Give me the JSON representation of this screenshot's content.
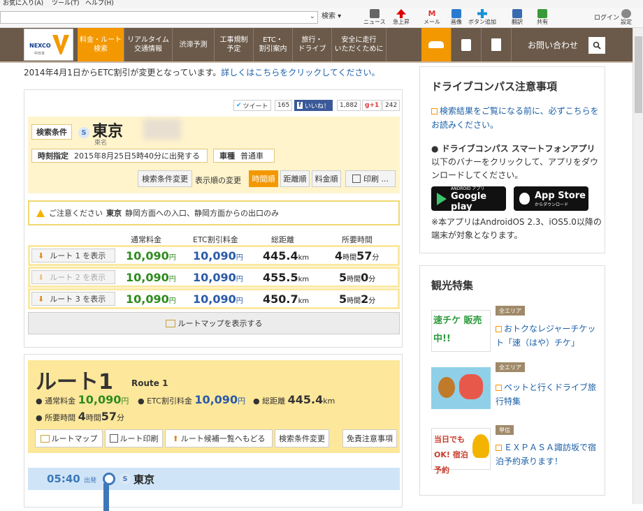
{
  "browser": {
    "menu": [
      "お気に入り(A)",
      "ツール(T)",
      "ヘルプ(H)"
    ],
    "search_label": "検索",
    "tools": [
      "ニュース",
      "急上昇",
      "メール",
      "画像",
      "ボタン追加",
      "翻訳",
      "共有"
    ],
    "login": "ログイン",
    "settings": "設定"
  },
  "nav": {
    "logo_text": "NEXCO",
    "logo_sub": "中日本",
    "items": [
      "料金・ルート\n検索",
      "リアルタイム\n交通情報",
      "渋滞予測",
      "工事規制\n予定",
      "ETC・\n割引案内",
      "旅行・\nドライブ",
      "安全に走行\nいただくために"
    ],
    "contact": "お問い合わせ"
  },
  "notice": {
    "text": "2014年4月1日からETC割引が変更となっています。",
    "link": "詳しくはこちらをクリックしてください。"
  },
  "social": {
    "tweet": "ツイート",
    "tweet_count": "165",
    "like": "いいね！",
    "like_count": "1,882",
    "gplus": "g+1",
    "gplus_count": "242"
  },
  "conditions": {
    "label": "検索条件",
    "origin": "東京",
    "origin_sub": "東名",
    "time_label": "時刻指定",
    "time_value": "2015年8月25日5時40分に出発する",
    "car_label": "車種",
    "car_value": "普通車",
    "change_btn": "検索条件変更",
    "sort_label": "表示順の変更",
    "sort_time": "時間順",
    "sort_dist": "距離順",
    "sort_fee": "料金順",
    "print": "印刷 ..."
  },
  "warning": {
    "prefix": "ご注意ください",
    "place": "東京",
    "text": "静岡方面への入口、静岡方面からの出口のみ"
  },
  "routes_table": {
    "headers": [
      "通常料金",
      "ETC割引料金",
      "総距離",
      "所要時間"
    ],
    "rows": [
      {
        "label": "ルート 1 を表示",
        "fee": "10,090",
        "etc": "10,090",
        "dist": "445.4",
        "hours": "4",
        "mins": "57"
      },
      {
        "label": "ルート 2 を表示",
        "fee": "10,090",
        "etc": "10,090",
        "dist": "455.5",
        "hours": "5",
        "mins": "0"
      },
      {
        "label": "ルート 3 を表示",
        "fee": "10,090",
        "etc": "10,090",
        "dist": "450.7",
        "hours": "5",
        "mins": "2"
      }
    ],
    "yen": "円",
    "km": "km",
    "hour_unit": "時間",
    "min_unit": "分",
    "map_btn": "ルートマップを表示する"
  },
  "route1": {
    "title": "ルート1",
    "subtitle": "Route 1",
    "fee_label": "通常料金",
    "fee": "10,090",
    "etc_label": "ETC割引料金",
    "etc": "10,090",
    "dist_label": "総距離",
    "dist": "445.4",
    "time_label": "所要時間",
    "hours": "4",
    "mins": "57",
    "buttons": [
      "ルートマップ",
      "ルート印刷",
      "ルート候補一覧へもどる",
      "検索条件変更",
      "免責注意事項"
    ],
    "dep_time": "05:40",
    "dep_label": "出発",
    "dep_place": "東京"
  },
  "side1": {
    "title": "ドライブコンパス注意事項",
    "link": "検索結果をご覧になる前に、必ずこちらをお読みください。",
    "app_title": "ドライブコンパス スマートフォンアプリ",
    "app_text": "以下のバナーをクリックして、アプリをダウンロードしてください。",
    "gp_small": "ANDROID アプリ",
    "gp_big": "Google play",
    "as_big": "App Store",
    "as_small": "からダウンロード",
    "note": "※本アプリはAndroidOS 2.3、iOS5.0以降の端末が対象となります。"
  },
  "side2": {
    "title": "観光特集",
    "items": [
      {
        "tag": "全エリア",
        "text": "おトクなレジャーチケット「速（はや）チケ」",
        "banner": "速チケ 販売中!!"
      },
      {
        "tag": "全エリア",
        "text": "ペットと行くドライブ旅行特集",
        "banner": ""
      },
      {
        "tag": "甲信",
        "text": "ＥＸＰＡＳＡ諏訪坂で宿泊予約承ります！",
        "banner": "当日でもOK! 宿泊予約"
      }
    ]
  }
}
